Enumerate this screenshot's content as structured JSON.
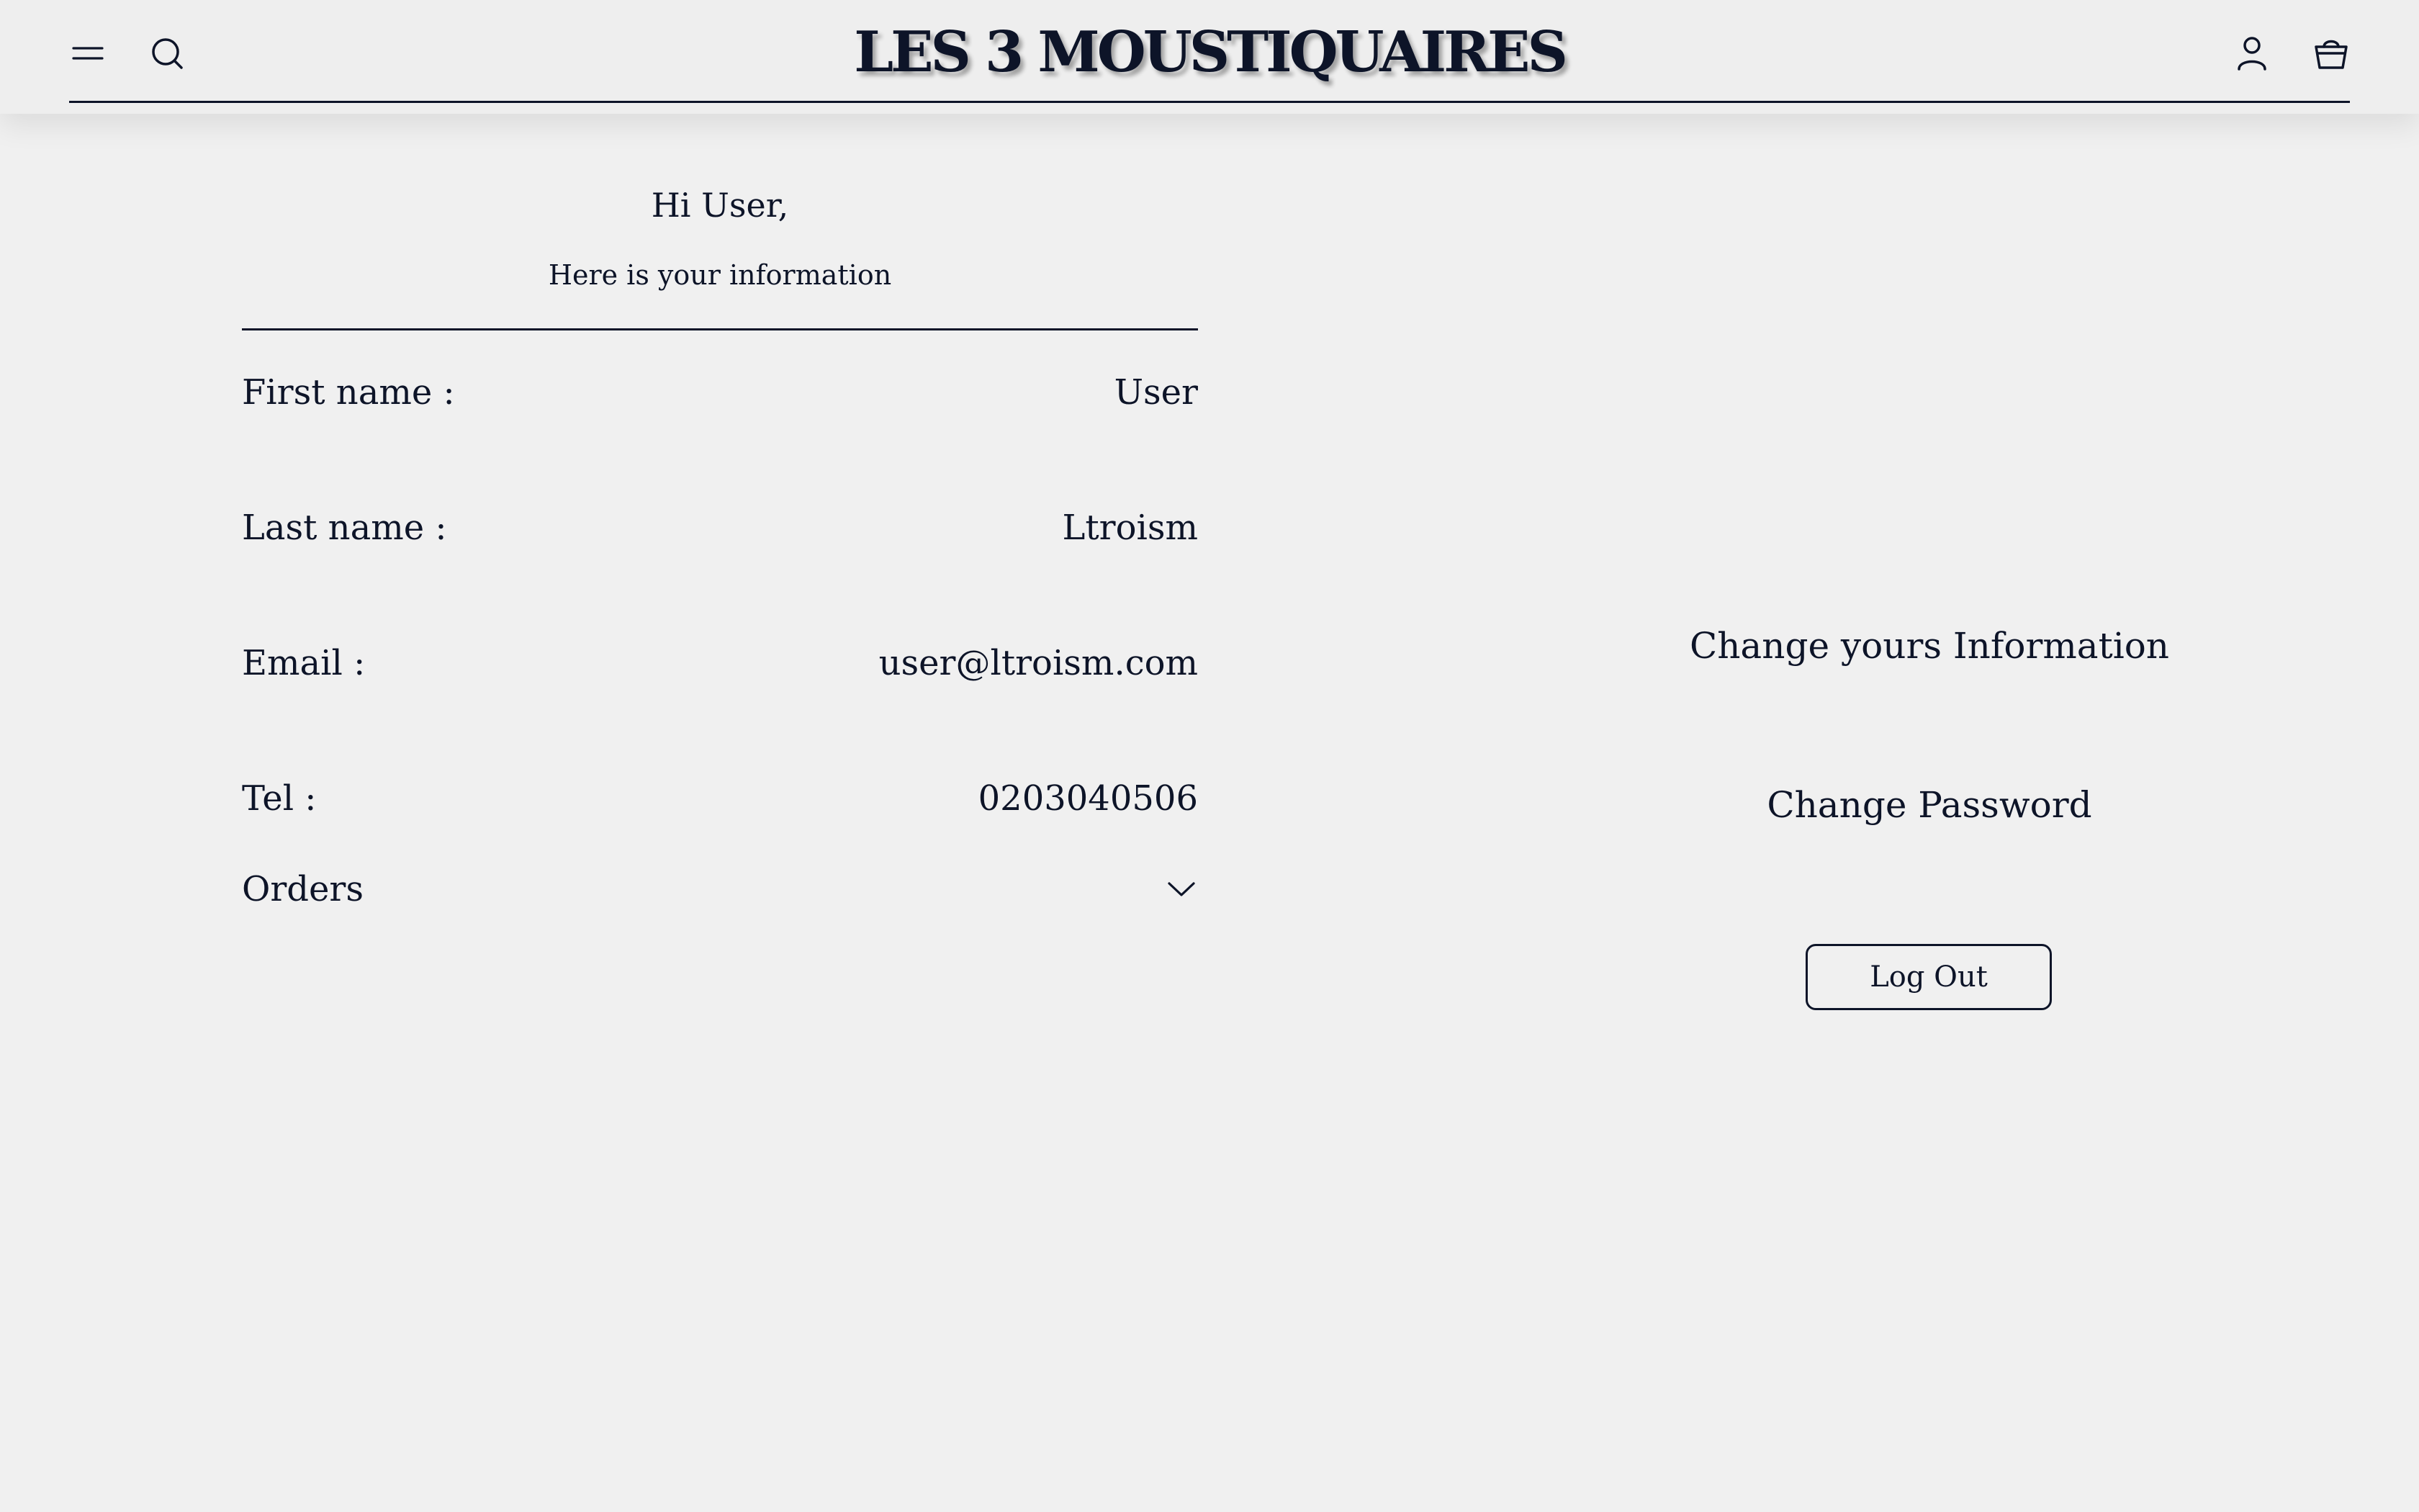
{
  "header": {
    "logo": "LES 3 MOUSTIQUAIRES",
    "icons": {
      "menu": "menu-icon",
      "search": "search-icon",
      "account": "account-icon",
      "cart": "basket-icon"
    }
  },
  "profile": {
    "greeting": "Hi User,",
    "subtitle": "Here is your information",
    "fields": [
      {
        "label": "First name :",
        "value": "User"
      },
      {
        "label": "Last name :",
        "value": "Ltroism"
      },
      {
        "label": "Email :",
        "value": "user@ltroism.com"
      },
      {
        "label": "Tel :",
        "value": "0203040506"
      }
    ],
    "orders_label": "Orders",
    "orders_icon": "chevron-down-icon"
  },
  "actions": {
    "change_info": "Change yours Information",
    "change_password": "Change Password",
    "logout": "Log Out"
  },
  "colors": {
    "background": "#f0f0f0",
    "text": "#0d1428"
  }
}
